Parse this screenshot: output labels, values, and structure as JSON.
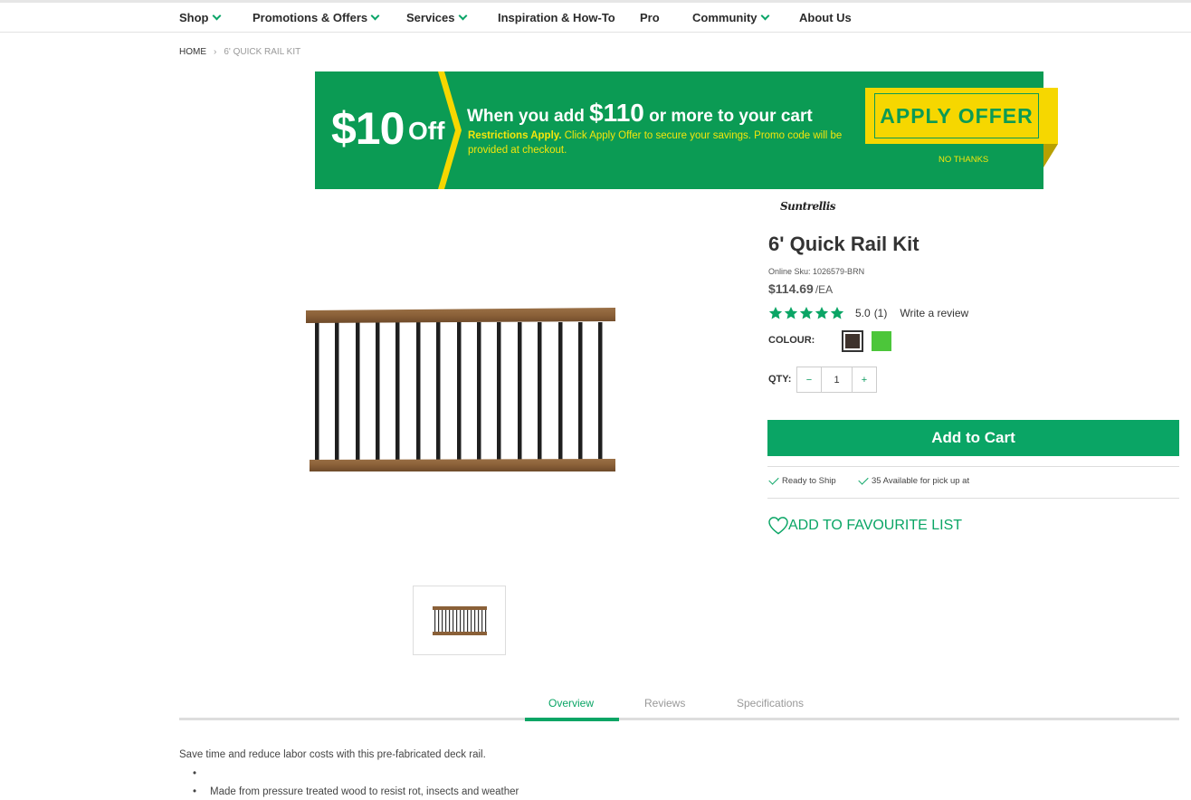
{
  "nav": {
    "items": [
      {
        "label": "Shop",
        "dropdown": true
      },
      {
        "label": "Promotions & Offers",
        "dropdown": true
      },
      {
        "label": "Services",
        "dropdown": true
      },
      {
        "label": "Inspiration & How-To",
        "dropdown": false
      },
      {
        "label": "Pro",
        "dropdown": false
      },
      {
        "label": "Community",
        "dropdown": true
      },
      {
        "label": "About Us",
        "dropdown": false
      }
    ]
  },
  "breadcrumb": {
    "home": "HOME",
    "separator": "›",
    "current": "6' QUICK RAIL KIT"
  },
  "promo": {
    "amount": "$10",
    "off": "Off",
    "headline_pre": "When you add ",
    "headline_amount": "$110",
    "headline_post": " or more to your cart",
    "restrictions_bold": "Restrictions Apply.",
    "restrictions_text": " Click Apply Offer to secure your savings. Promo code will be provided at checkout.",
    "apply_label": "APPLY OFFER",
    "no_thanks_label": "NO THANKS",
    "colors": {
      "background": "#0b9b54",
      "accent": "#f6d700",
      "sub_text": "#f4e60c"
    }
  },
  "product": {
    "brand": "Suntrellis",
    "title": "6' Quick Rail Kit",
    "sku": "Online Sku: 1026579-BRN",
    "price": "$114.69",
    "unit": "/EA",
    "rating": {
      "stars": 5,
      "score": "5.0",
      "count": "(1)",
      "write_review": "Write a review",
      "star_color": "#0aa565"
    },
    "colour_label": "COLOUR:",
    "colours": [
      {
        "name": "brown",
        "hex": "#3e322c",
        "selected": true
      },
      {
        "name": "green",
        "hex": "#4cc63a",
        "selected": false
      }
    ],
    "qty_label": "QTY:",
    "qty_minus": "−",
    "qty_value": "1",
    "qty_plus": "+",
    "add_to_cart": "Add to Cart",
    "availability": [
      {
        "text": "Ready to Ship"
      },
      {
        "text": "35 Available for pick up at"
      }
    ],
    "favourite": "ADD TO FAVOURITE LIST",
    "brand_color": "#0aa565"
  },
  "tabs": [
    {
      "label": "Overview",
      "active": true
    },
    {
      "label": "Reviews",
      "active": false
    },
    {
      "label": "Specifications",
      "active": false
    }
  ],
  "description": {
    "intro": "Save time and reduce labor costs with this pre-fabricated deck rail.",
    "bullets": [
      "",
      "Made from pressure treated wood to resist rot, insects and weather"
    ],
    "bullet_char": "•"
  }
}
